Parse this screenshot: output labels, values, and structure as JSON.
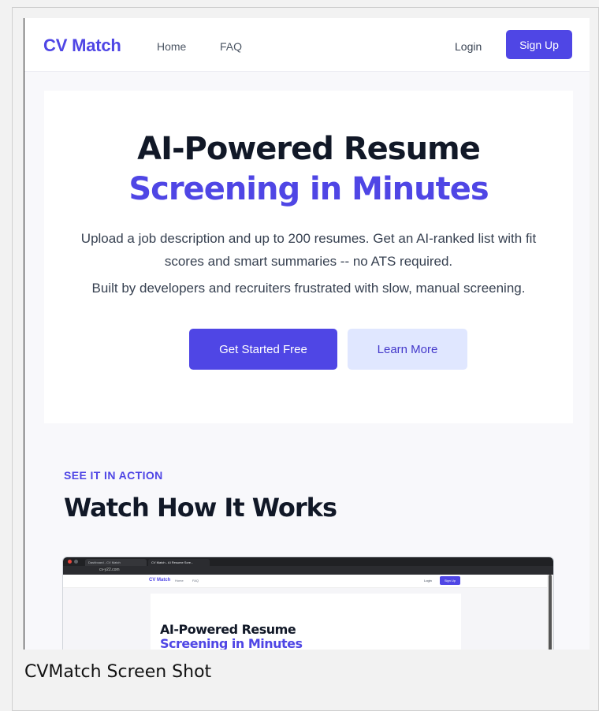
{
  "navbar": {
    "brand": "CV Match",
    "links": [
      "Home",
      "FAQ"
    ],
    "login": "Login",
    "signup": "Sign Up"
  },
  "hero": {
    "title_line1": "AI-Powered Resume",
    "title_line2": "Screening in Minutes",
    "subtitle": "Upload a job description and up to 200 resumes. Get an AI-ranked list with fit scores and smart summaries -- no ATS required.",
    "note": "Built by developers and recruiters frustrated with slow, manual screening.",
    "primary_button": "Get Started Free",
    "secondary_button": "Learn More"
  },
  "action_section": {
    "eyebrow": "SEE IT IN ACTION",
    "title": "Watch How It Works"
  },
  "embedded_screenshot": {
    "tabs": [
      "Dashboard - CV Match",
      "CV Match - AI Resume Scre..."
    ],
    "address": "cv-y22.com",
    "brand": "CV Match",
    "links": [
      "Home",
      "FAQ"
    ],
    "login": "Login",
    "signup": "Sign Up",
    "title_line1": "AI-Powered Resume",
    "title_line2": "Screening in Minutes"
  },
  "caption": "CVMatch Screen Shot",
  "colors": {
    "accent": "#4f46e5",
    "accent_light": "#e0e7ff",
    "heading": "#111827",
    "body_text": "#374151"
  }
}
